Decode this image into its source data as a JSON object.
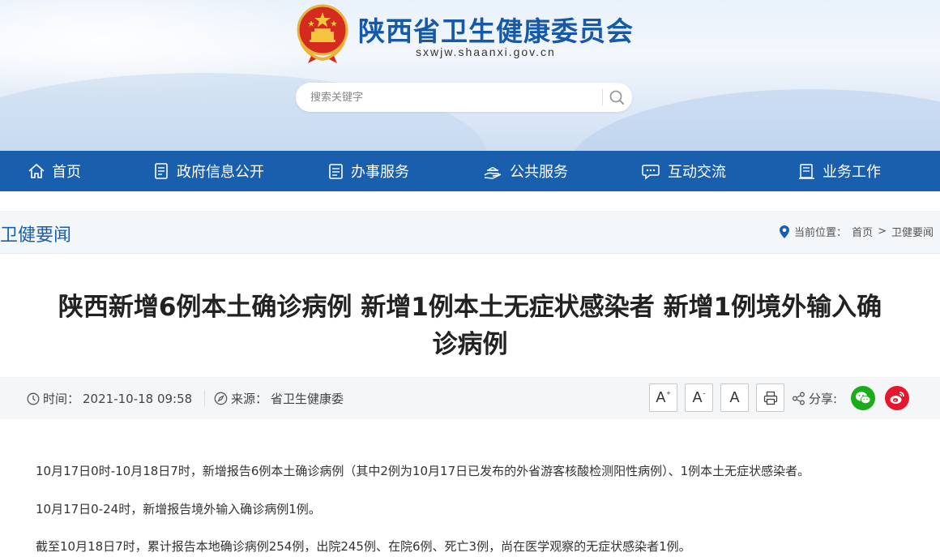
{
  "header": {
    "site_title": "陕西省卫生健康委员会",
    "domain": "sxwjw.shaanxi.gov.cn",
    "search_placeholder": "搜索关键字"
  },
  "nav": {
    "items": [
      {
        "label": "首页",
        "icon": "home-icon"
      },
      {
        "label": "政府信息公开",
        "icon": "document-list-icon"
      },
      {
        "label": "办事服务",
        "icon": "clipboard-icon"
      },
      {
        "label": "公共服务",
        "icon": "hand-service-icon"
      },
      {
        "label": "互动交流",
        "icon": "chat-bubble-icon"
      },
      {
        "label": "业务工作",
        "icon": "ledger-icon"
      }
    ]
  },
  "column": {
    "title": "卫健要闻",
    "breadcrumb_label": "当前位置：",
    "breadcrumb": [
      "首页",
      "卫健要闻"
    ],
    "breadcrumb_sep": ">"
  },
  "article": {
    "title_line1": "陕西新增6例本土确诊病例 新增1例本土无症状感染者 新增1例境外输入确",
    "title_line2": "诊病例",
    "time_label": "时间：",
    "time_value": "2021-10-18 09:58",
    "source_label": "来源：",
    "source_value": "省卫生健康委",
    "font_large": "A",
    "font_small": "A",
    "font_normal": "A",
    "share_label": "分享:",
    "paragraphs": [
      "10月17日0时-10月18日7时，新增报告6例本土确诊病例（其中2例为10月17日已发布的外省游客核酸检测阳性病例）、1例本土无症状感染者。",
      "10月17日0-24时，新增报告境外输入确诊病例1例。",
      "截至10月18日7时，累计报告本地确诊病例254例，出院245例、在院6例、死亡3例，尚在医学观察的无症状感染者1例。"
    ]
  },
  "colors": {
    "brand_blue": "#1a5fae",
    "wechat_green": "#1aad19",
    "weibo_red": "#e6162d"
  }
}
